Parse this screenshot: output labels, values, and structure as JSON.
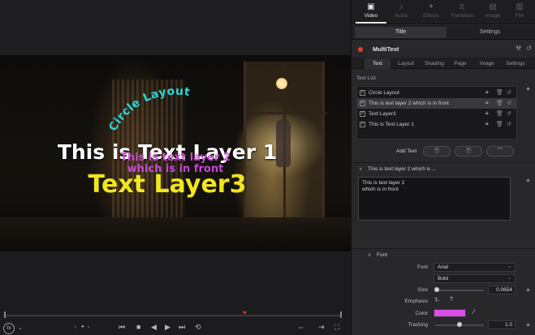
{
  "viewer": {
    "overlay": {
      "circle_text": "Circle Layout",
      "layer1": "This is Text Layer 1",
      "layer2_line1": "This is text layer 2",
      "layer2_line2": "which is in front",
      "layer3": "Text Layer3"
    },
    "zoom_badge": "fx",
    "colors": {
      "circle_text": "#2ad7d7",
      "layer1": "#ffffff",
      "layer2": "#d54ce5",
      "layer3": "#f1e51e",
      "playhead": "#e53030"
    }
  },
  "inspector": {
    "page_tabs": [
      {
        "label": "Video",
        "icon": "video-icon",
        "glyph": "▣",
        "active": true
      },
      {
        "label": "Audio",
        "icon": "audio-icon",
        "glyph": "♪",
        "active": false
      },
      {
        "label": "Effects",
        "icon": "effects-icon",
        "glyph": "✦",
        "active": false
      },
      {
        "label": "Transition",
        "icon": "transition-icon",
        "glyph": "⧖",
        "active": false
      },
      {
        "label": "Image",
        "icon": "image-icon",
        "glyph": "▤",
        "active": false
      },
      {
        "label": "File",
        "icon": "file-icon",
        "glyph": "▥",
        "active": false
      }
    ],
    "title_tabs": [
      {
        "label": "Title",
        "active": true
      },
      {
        "label": "Settings",
        "active": false
      }
    ],
    "tool_name": "MultiText",
    "sub_tabs": [
      {
        "label": "Text",
        "active": true
      },
      {
        "label": "Layout",
        "active": false
      },
      {
        "label": "Shading",
        "active": false
      },
      {
        "label": "Page",
        "active": false
      },
      {
        "label": "Image",
        "active": false
      },
      {
        "label": "Settings",
        "active": false
      }
    ],
    "text_list_label": "Text List",
    "text_list": [
      {
        "label": "Circle Layout",
        "checked": true,
        "selected": false
      },
      {
        "label": "This is text layer 2 which is in front",
        "checked": true,
        "selected": true
      },
      {
        "label": "Text Layer3",
        "checked": true,
        "selected": false
      },
      {
        "label": "This is Text Layer 1",
        "checked": true,
        "selected": false
      }
    ],
    "add_text_label": "Add Text",
    "edit_section_label": "This is text layer 2 which is ...",
    "text_value_line1": "This is text layer 2",
    "text_value_line2": "which is in front",
    "font_section_label": "Font",
    "props": {
      "font_label": "Font",
      "font_value": "Arial",
      "style_value": "Bold",
      "size_label": "Size",
      "size_value": "0.0654",
      "size_level": 0.03,
      "emphasis_label": "Emphasis",
      "color_label": "Color",
      "color_value": "#d94fe8",
      "tracking_label": "Tracking",
      "tracking_value": "1.0",
      "tracking_level": 0.5
    }
  }
}
